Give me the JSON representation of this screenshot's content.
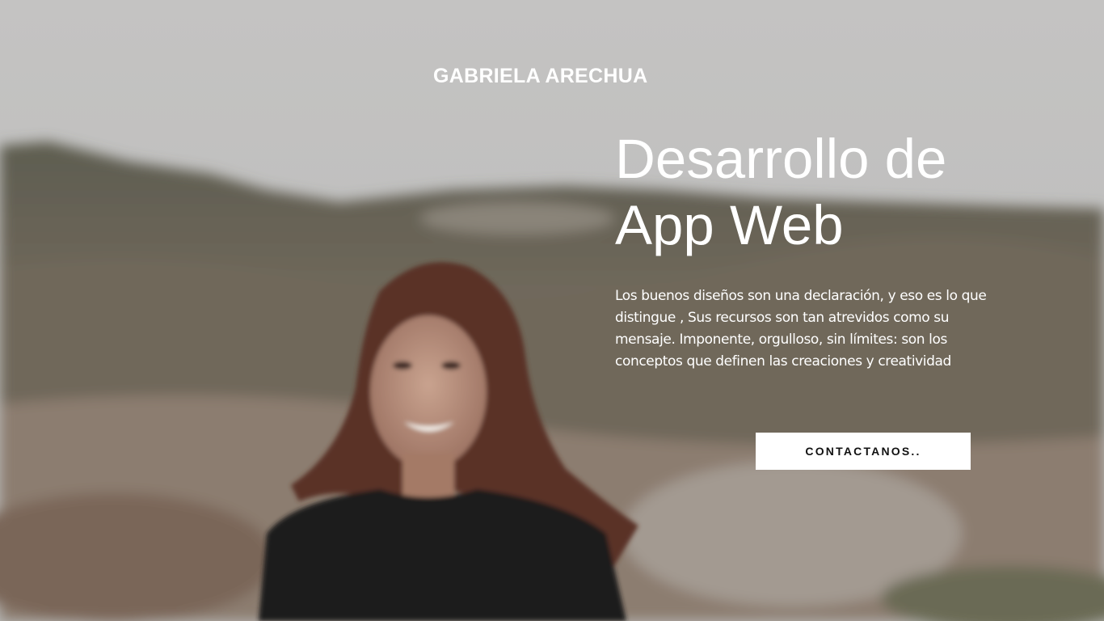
{
  "brand": {
    "name": "GABRIELA ARECHUA"
  },
  "hero": {
    "headline_lines": [
      "Desarrollo de",
      "App Web"
    ],
    "description_lines": [
      "Los buenos diseños son una declaración, y eso es lo que",
      "distingue , Sus recursos son tan atrevidos como su",
      "mensaje. Imponente, orgulloso, sin límites: son los",
      "conceptos que definen las creaciones y creatividad"
    ],
    "cta_label": "CONTACTANOS.."
  },
  "colors": {
    "text": "#ffffff",
    "button_bg": "#ffffff",
    "button_text": "#111111",
    "sky": "#c9c8c6",
    "hills": "#6d6a5d"
  }
}
